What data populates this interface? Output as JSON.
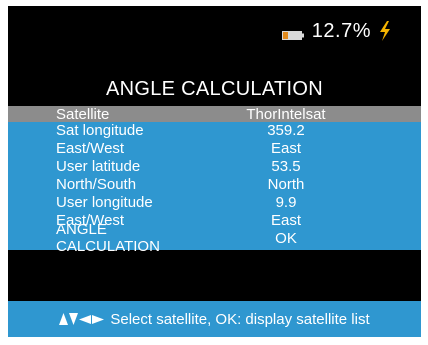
{
  "status": {
    "battery_percent": "12.7%",
    "battery_icon": "battery-low-icon",
    "charging_icon": "lightning-bolt-icon"
  },
  "title": "ANGLE CALCULATION",
  "rows": [
    {
      "label": "Satellite",
      "value": "ThorIntelsat"
    },
    {
      "label": "Sat longitude",
      "value": "359.2"
    },
    {
      "label": "East/West",
      "value": "East"
    },
    {
      "label": "User latitude",
      "value": "53.5"
    },
    {
      "label": "North/South",
      "value": "North"
    },
    {
      "label": "User longitude",
      "value": "9.9"
    },
    {
      "label": "East/West",
      "value": "East"
    },
    {
      "label": "ANGLE CALCULATION",
      "value": "OK"
    }
  ],
  "help": {
    "icons": [
      "arrow-up-icon",
      "arrow-down-icon",
      "arrow-left-icon",
      "arrow-right-icon"
    ],
    "text": "Select satellite, OK: display satellite list"
  },
  "colors": {
    "background": "#000000",
    "panel": "#2f97d0",
    "selected_row": "#8c8c8c",
    "bolt": "#f5b400"
  }
}
